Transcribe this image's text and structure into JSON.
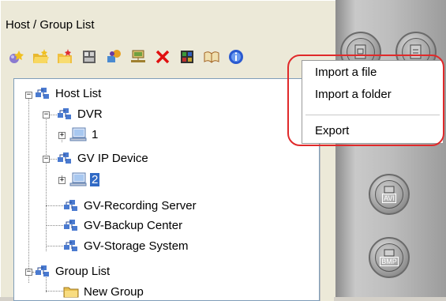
{
  "panel": {
    "title": "Host / Group List"
  },
  "toolbar": {
    "icons": [
      "add-host-icon",
      "open-folder-icon",
      "new-folder-icon",
      "properties-icon",
      "connect-icon",
      "network-icon",
      "delete-icon",
      "monitor-icon",
      "book-icon",
      "info-icon"
    ]
  },
  "tree": {
    "host_list": "Host List",
    "dvr": "DVR",
    "dvr_child": "1",
    "gv_ip_device": "GV IP Device",
    "gv_ip_child": "2",
    "recording_server": "GV-Recording Server",
    "backup_center": "GV-Backup Center",
    "storage_system": "GV-Storage System",
    "group_list": "Group List",
    "new_group": "New Group"
  },
  "context_menu": {
    "import_file": "Import a file",
    "import_folder": "Import a folder",
    "export": "Export"
  },
  "right_buttons": {
    "avi_label": "AVI",
    "bmp_label": "BMP"
  },
  "colors": {
    "selection": "#316ac5",
    "highlight_ring": "#e0292a"
  }
}
